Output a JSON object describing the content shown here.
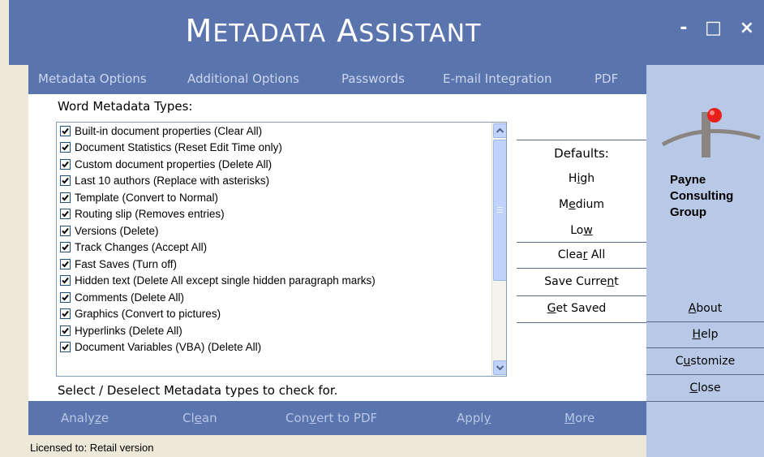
{
  "title": "Metadata Assistant",
  "window_controls": {
    "minimize": "-",
    "maximize": "□",
    "close": "×"
  },
  "tabs": [
    "Metadata Options",
    "Additional Options",
    "Passwords",
    "E-mail Integration",
    "PDF"
  ],
  "panel_caption": "Word Metadata Types:",
  "metadata_items": [
    {
      "label": "Built-in document properties (Clear All)",
      "checked": true
    },
    {
      "label": "Document Statistics (Reset Edit Time only)",
      "checked": true
    },
    {
      "label": "Custom document properties (Delete All)",
      "checked": true
    },
    {
      "label": "Last 10 authors (Replace with asterisks)",
      "checked": true
    },
    {
      "label": "Template (Convert to Normal)",
      "checked": true
    },
    {
      "label": "Routing slip (Removes entries)",
      "checked": true
    },
    {
      "label": "Versions (Delete)",
      "checked": true
    },
    {
      "label": "Track Changes (Accept All)",
      "checked": true
    },
    {
      "label": "Fast Saves (Turn off)",
      "checked": true
    },
    {
      "label": "Hidden text (Delete All except single hidden paragraph marks)",
      "checked": true
    },
    {
      "label": "Comments (Delete All)",
      "checked": true
    },
    {
      "label": "Graphics (Convert to pictures)",
      "checked": true
    },
    {
      "label": "Hyperlinks (Delete All)",
      "checked": true
    },
    {
      "label": "Document Variables (VBA) (Delete All)",
      "checked": true
    }
  ],
  "hint": "Select / Deselect Metadata types to check for.",
  "defaults": {
    "label": "Defaults:",
    "high": {
      "pre": "H",
      "key": "i",
      "post": "gh"
    },
    "medium": {
      "pre": "M",
      "key": "e",
      "post": "dium"
    },
    "low": {
      "pre": "Lo",
      "key": "w",
      "post": ""
    }
  },
  "side_buttons": {
    "clear_all": {
      "pre": "Clea",
      "key": "r",
      "post": " All"
    },
    "save_current": {
      "pre": "Save Curre",
      "key": "n",
      "post": "t"
    },
    "get_saved": {
      "pre": "",
      "key": "G",
      "post": "et Saved"
    }
  },
  "right_buttons": {
    "about": {
      "pre": "",
      "key": "A",
      "post": "bout"
    },
    "help": {
      "pre": "",
      "key": "H",
      "post": "elp"
    },
    "customize": {
      "pre": "C",
      "key": "u",
      "post": "stomize"
    },
    "close": {
      "pre": "",
      "key": "C",
      "post": "lose"
    }
  },
  "brand": {
    "line1": "Payne",
    "line2": "Consulting",
    "line3": "Group"
  },
  "actions": {
    "analyze": {
      "pre": "Analy",
      "key": "z",
      "post": "e"
    },
    "clean": {
      "pre": "Cl",
      "key": "e",
      "post": "an"
    },
    "convert": {
      "pre": "Con",
      "key": "v",
      "post": "ert to PDF"
    },
    "apply": {
      "pre": "Appl",
      "key": "y",
      "post": ""
    },
    "more": {
      "pre": "",
      "key": "M",
      "post": "ore"
    }
  },
  "status": "Licensed to: Retail version",
  "colors": {
    "header_blue": "#5a75ad",
    "side_blue": "#b7c9e6",
    "logo_red": "#e8201b"
  }
}
